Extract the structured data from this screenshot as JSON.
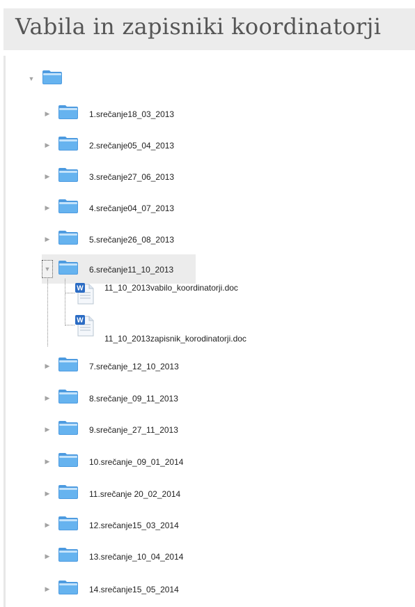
{
  "page": {
    "title": "Vabila in zapisniki koordinatorji"
  },
  "tree": {
    "root": {
      "label": "",
      "expanded": true,
      "toggle_glyph": "▼",
      "icon": "folder-icon"
    },
    "folders": [
      {
        "label": "1.srečanje18_03_2013",
        "expanded": false,
        "toggle_glyph": "▶"
      },
      {
        "label": "2.srečanje05_04_2013",
        "expanded": false,
        "toggle_glyph": "▶"
      },
      {
        "label": "3.srečanje27_06_2013",
        "expanded": false,
        "toggle_glyph": "▶"
      },
      {
        "label": "4.srečanje04_07_2013",
        "expanded": false,
        "toggle_glyph": "▶"
      },
      {
        "label": "5.srečanje26_08_2013",
        "expanded": false,
        "toggle_glyph": "▶"
      },
      {
        "label": "6.srečanje11_10_2013",
        "expanded": true,
        "selected": true,
        "toggle_glyph": "▼",
        "files": [
          {
            "label": "11_10_2013vabilo_koordinatorji.doc",
            "icon": "word-document-icon"
          },
          {
            "label": "11_10_2013zapisnik_korodinatorji.doc",
            "icon": "word-document-icon"
          }
        ]
      },
      {
        "label": "7.srečanje_12_10_2013",
        "expanded": false,
        "toggle_glyph": "▶"
      },
      {
        "label": "8.srečanje_09_11_2013",
        "expanded": false,
        "toggle_glyph": "▶"
      },
      {
        "label": "9.srečanje_27_11_2013",
        "expanded": false,
        "toggle_glyph": "▶"
      },
      {
        "label": "10.srečanje_09_01_2014",
        "expanded": false,
        "toggle_glyph": "▶"
      },
      {
        "label": "11.srečanje 20_02_2014",
        "expanded": false,
        "toggle_glyph": "▶"
      },
      {
        "label": "12.srečanje15_03_2014",
        "expanded": false,
        "toggle_glyph": "▶"
      },
      {
        "label": "13.srečanje_10_04_2014",
        "expanded": false,
        "toggle_glyph": "▶"
      },
      {
        "label": "14.srečanje15_05_2014",
        "expanded": false,
        "toggle_glyph": "▶"
      }
    ]
  },
  "colors": {
    "header_bg": "#ececec",
    "selected_row_bg": "#ececec",
    "folder_fill": "#55a3e6",
    "folder_light": "#bfe0fb",
    "word_blue": "#2b6cc4",
    "toggle": "#a3a3a3"
  }
}
